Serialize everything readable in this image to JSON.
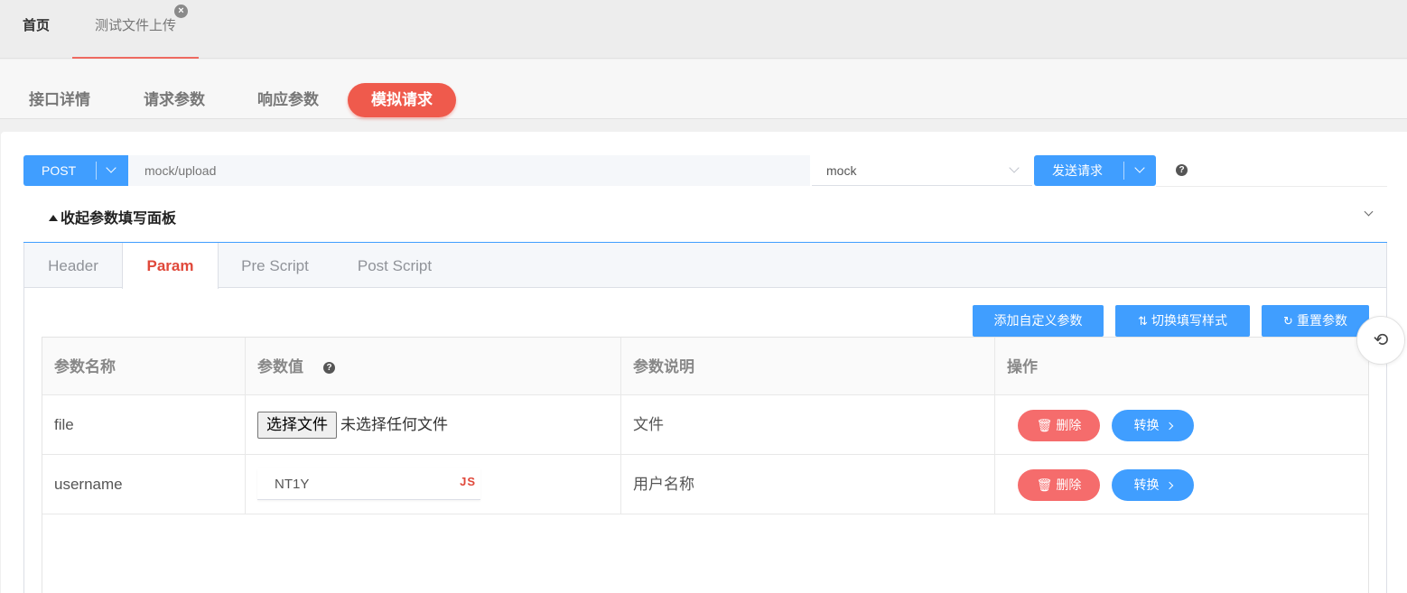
{
  "top_tabs": {
    "home": "首页",
    "current": "测试文件上传",
    "close_glyph": "×"
  },
  "section_tabs": [
    "接口详情",
    "请求参数",
    "响应参数",
    "模拟请求"
  ],
  "active_section": "模拟请求",
  "request": {
    "method": "POST",
    "url_placeholder": "mock/upload",
    "environment": "mock",
    "send_label": "发送请求",
    "help_glyph": "?"
  },
  "panel": {
    "collapse_label": "收起参数填写面板",
    "tabs": [
      "Header",
      "Param",
      "Pre Script",
      "Post Script"
    ],
    "active_tab": "Param",
    "actions": {
      "add_custom": "添加自定义参数",
      "switch_style": "切换填写样式",
      "reset": "重置参数"
    }
  },
  "table": {
    "headers": [
      "参数名称",
      "参数值",
      "参数说明",
      "操作"
    ],
    "rows": [
      {
        "name": "file",
        "file_button": "选择文件",
        "file_status": "未选择任何文件",
        "description": "文件",
        "delete_label": "删除",
        "convert_label": "转换"
      },
      {
        "name": "username",
        "value": "NT1Y",
        "value_tag": "JS",
        "description": "用户名称",
        "delete_label": "删除",
        "convert_label": "转换"
      }
    ]
  },
  "colors": {
    "primary": "#409eff",
    "accent": "#ef5a4c",
    "danger": "#f56c6c",
    "active_tab_text": "#e0483a"
  },
  "icons": [
    "close-icon",
    "chevron-down-icon",
    "help-icon",
    "triangle-up-icon",
    "swap-icon",
    "refresh-icon",
    "history-icon",
    "trash-icon",
    "chevron-right-icon"
  ]
}
